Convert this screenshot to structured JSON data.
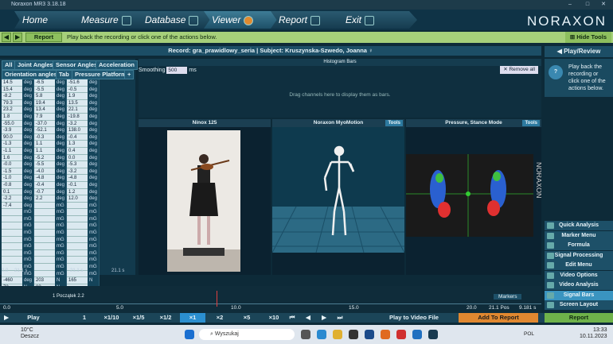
{
  "window": {
    "title": "Noraxon MR3 3.18.18",
    "min": "–",
    "max": "□",
    "close": "✕"
  },
  "nav": {
    "tabs": [
      "Home",
      "Measure",
      "Database",
      "Viewer",
      "Report",
      "Exit"
    ],
    "active": "Viewer",
    "logo": "NORAXON"
  },
  "toolbar": {
    "report_label": "Report",
    "message": "Play back the recording or click one of the actions below.",
    "hide_tools": "Hide Tools"
  },
  "record_bar": "Record: gra_prawidlowy_seria | Subject: Kruszynska-Szwedo, Joanna ♀",
  "left_panel": {
    "tabs_row1": [
      "All",
      "Joint Angles",
      "Sensor Angles",
      "Acceleration"
    ],
    "tabs_row2": [
      "Orientation angles",
      "Tab",
      "Pressure Platform"
    ],
    "plus": "+",
    "rows": [
      [
        "14.5",
        "deg",
        "-6.5",
        "deg",
        "-51.6",
        "deg"
      ],
      [
        "15.4",
        "deg",
        "-5.5",
        "deg",
        "-0.5",
        "deg"
      ],
      [
        "-8.2",
        "deg",
        "5.8",
        "deg",
        "1.9",
        "deg"
      ],
      [
        "79.3",
        "deg",
        "19.4",
        "deg",
        "13.5",
        "deg"
      ],
      [
        "23.2",
        "deg",
        "13.4",
        "deg",
        "22.1",
        "deg"
      ],
      [
        "1.8",
        "deg",
        "7.9",
        "deg",
        "-19.8",
        "deg"
      ],
      [
        "-55.0",
        "deg",
        "-37.0",
        "deg",
        "-3.2",
        "deg"
      ],
      [
        "-3.9",
        "deg",
        "-52.1",
        "deg",
        "138.0",
        "deg"
      ],
      [
        "90.0",
        "deg",
        "-0.3",
        "deg",
        "-0.4",
        "deg"
      ],
      [
        "-1.3",
        "deg",
        "1.1",
        "deg",
        "1.3",
        "deg"
      ],
      [
        "-1.1",
        "deg",
        "1.1",
        "deg",
        "0.4",
        "deg"
      ],
      [
        "1.6",
        "deg",
        "-5.2",
        "deg",
        "0.0",
        "deg"
      ],
      [
        "-0.0",
        "deg",
        "-5.5",
        "deg",
        "-5.3",
        "deg"
      ],
      [
        "-1.5",
        "deg",
        "-4.0",
        "deg",
        "-3.2",
        "deg"
      ],
      [
        "-1.0",
        "deg",
        "-4.8",
        "deg",
        "-4.8",
        "deg"
      ],
      [
        "-0.8",
        "deg",
        "-0.4",
        "deg",
        "-0.1",
        "deg"
      ],
      [
        "0.1",
        "deg",
        "-0.7",
        "deg",
        "1.2",
        "deg"
      ],
      [
        "-2.2",
        "deg",
        "2.2",
        "deg",
        "12.0",
        "deg"
      ],
      [
        "-7.4",
        "deg",
        "",
        "mG",
        "",
        "mG"
      ],
      [
        "",
        "mG",
        "",
        "mG",
        "",
        "mG"
      ],
      [
        "",
        "mG",
        "",
        "mG",
        "",
        "mG"
      ],
      [
        "",
        "mG",
        "",
        "mG",
        "",
        "mG"
      ],
      [
        "",
        "mG",
        "",
        "mG",
        "",
        "mG"
      ],
      [
        "",
        "mG",
        "",
        "mG",
        "",
        "mG"
      ],
      [
        "",
        "mG",
        "",
        "mG",
        "",
        "mG"
      ],
      [
        "",
        "mG",
        "",
        "mG",
        "",
        "mG"
      ],
      [
        "",
        "mG",
        "",
        "mG",
        "",
        "mG"
      ],
      [
        "",
        "mG",
        "",
        "mG",
        "",
        "mG"
      ],
      [
        "",
        "mG",
        "",
        "mG",
        "",
        "mG"
      ],
      [
        "-460",
        "deg",
        "203",
        "N",
        "165",
        "N"
      ],
      [
        "72",
        "N",
        "83",
        "N",
        "",
        ""
      ]
    ],
    "footer_left": "0.0",
    "footer_mid": "21.1 s",
    "footer_right": "21.1 s"
  },
  "histogram": {
    "title": "Histogram Bars",
    "smoothing_label": "Smoothing",
    "smoothing_value": "500",
    "smoothing_unit": "ms",
    "remove_all": "Remove all",
    "drag_hint": "Drag channels here to display them as bars."
  },
  "panels": {
    "video": "Ninox 125",
    "myo": "Noraxon MyoMotion",
    "pressure": "Pressure, Stance Mode",
    "tools": "Tools",
    "pressure_watermark": "NORAXON"
  },
  "right_panel": {
    "header": "Play/Review",
    "hint": "Play back the recording or click one of the actions below.",
    "menu": [
      "Quick Analysis",
      "Marker Menu",
      "Formula",
      "Signal Processing",
      "Edit Menu",
      "Video Options",
      "Video Analysis",
      "Signal Bars",
      "Screen Layout"
    ],
    "active_menu": "Signal Bars",
    "report_button": "Report"
  },
  "timeline": {
    "label": "1 Początek 2.2",
    "markers": "Markers",
    "ticks": [
      "0.0",
      "5.0",
      "10.0",
      "15.0",
      "20.0"
    ],
    "end": "21.1 Pos",
    "pos": "9.181 s",
    "left": "0.0",
    "left2": "21.1"
  },
  "transport": {
    "play": "Play",
    "speeds": [
      "1",
      "×1/10",
      "×1/5",
      "×1/2",
      "×1",
      "×2",
      "×5",
      "×10"
    ],
    "active_speed": "×1",
    "play_to_video": "Play to Video File",
    "add_to_report": "Add To Report",
    "report": "Report"
  },
  "taskbar": {
    "temp": "10°C",
    "weather": "Deszcz",
    "search": "Wyszukaj",
    "time": "13:33",
    "date": "10.11.2023",
    "lang": "POL"
  }
}
